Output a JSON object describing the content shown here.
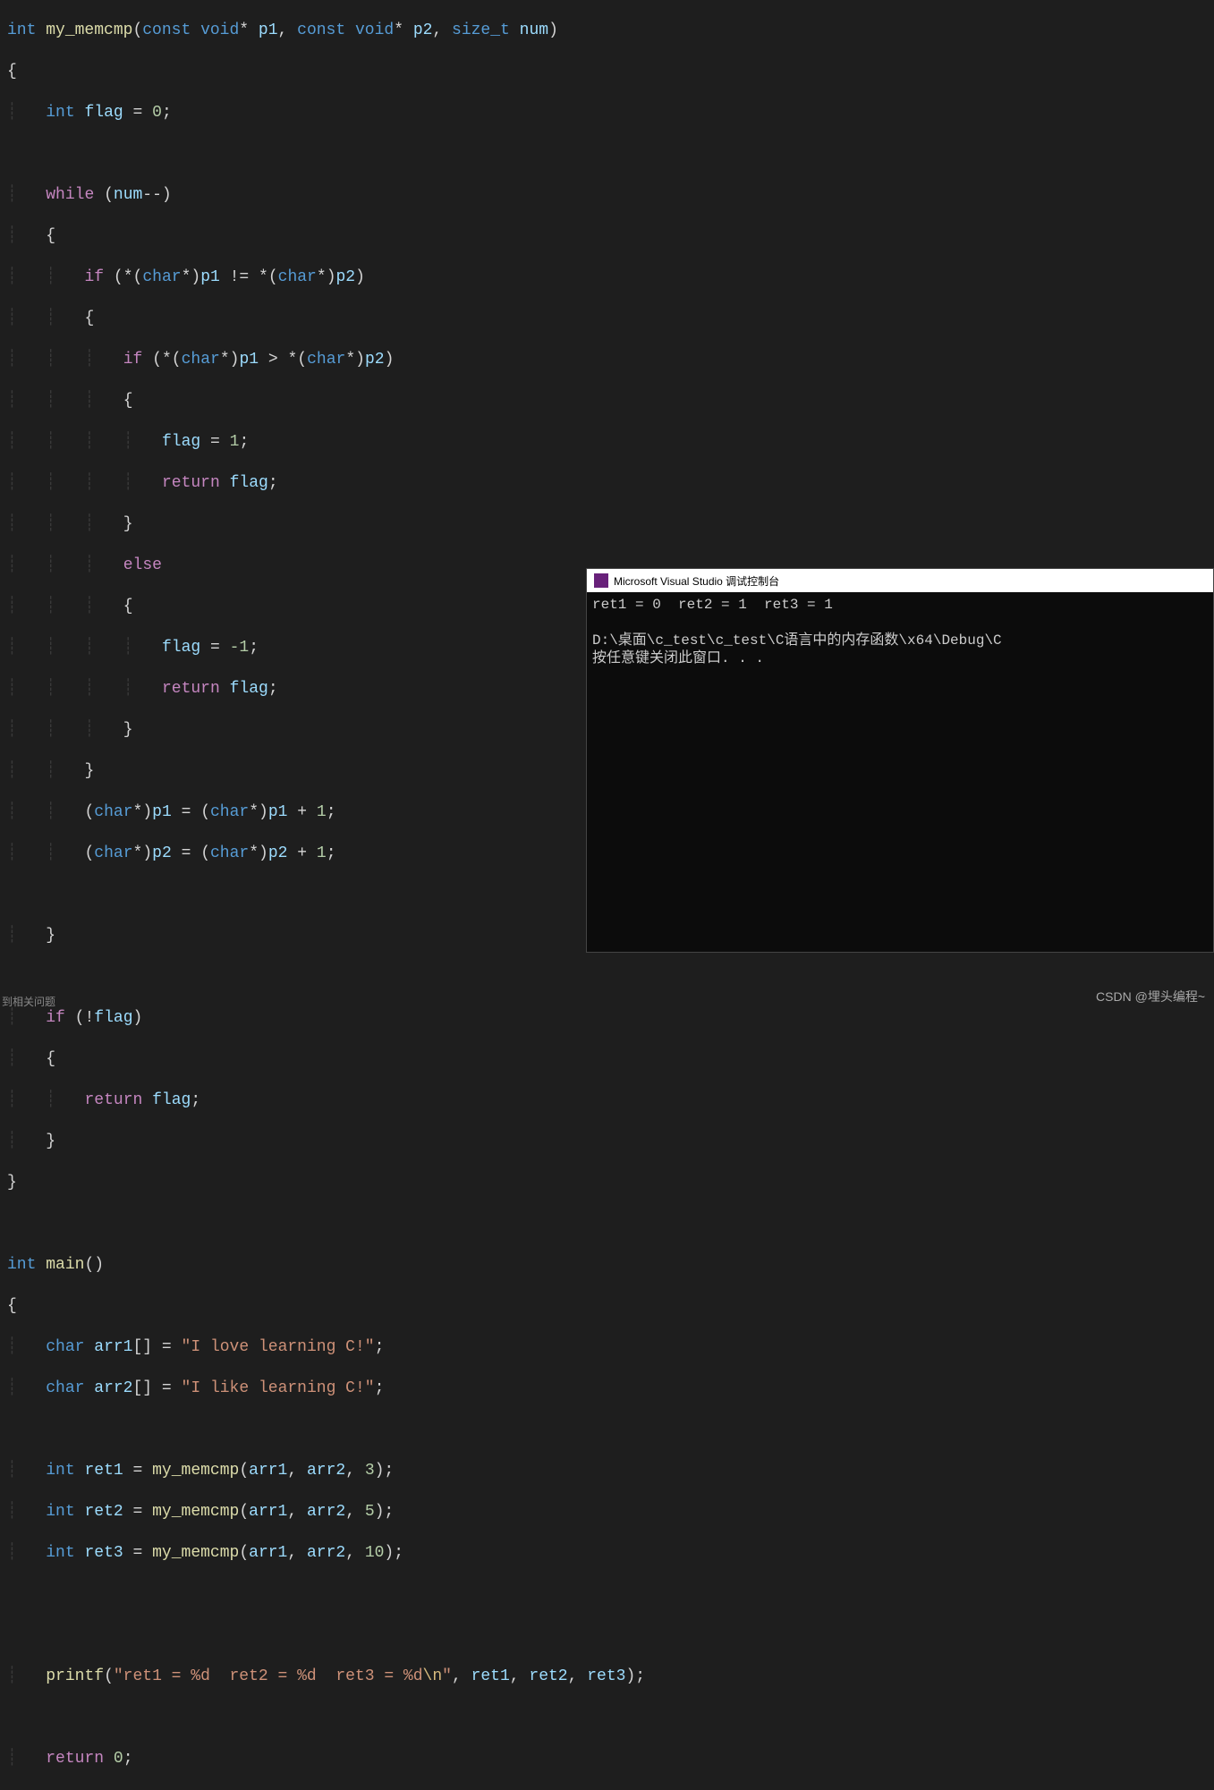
{
  "code": {
    "func_decl": {
      "ret": "int",
      "name": "my_memcmp",
      "params": [
        {
          "kw": "const",
          "type": "void",
          "ptr": "*",
          "name": "p1"
        },
        {
          "kw": "const",
          "type": "void",
          "ptr": "*",
          "name": "p2"
        },
        {
          "kw": "",
          "type": "size_t",
          "ptr": "",
          "name": "num"
        }
      ]
    },
    "flag_decl": {
      "type": "int",
      "name": "flag",
      "init": "0"
    },
    "while_kw": "while",
    "while_cond_var": "num",
    "while_op": "--",
    "if_kw": "if",
    "else_kw": "else",
    "return_kw": "return",
    "cast_type": "char",
    "cmp_ne": "!=",
    "cmp_gt": ">",
    "assign_1": "1",
    "assign_neg1": "-1",
    "plus_1": "1",
    "not_op": "!",
    "main_decl": {
      "ret": "int",
      "name": "main"
    },
    "arr1": {
      "type": "char",
      "name": "arr1",
      "lit": "\"I love learning C!\""
    },
    "arr2": {
      "type": "char",
      "name": "arr2",
      "lit": "\"I like learning C!\""
    },
    "ret1": {
      "type": "int",
      "name": "ret1",
      "call": "my_memcmp",
      "a1": "arr1",
      "a2": "arr2",
      "n": "3"
    },
    "ret2": {
      "type": "int",
      "name": "ret2",
      "call": "my_memcmp",
      "a1": "arr1",
      "a2": "arr2",
      "n": "5"
    },
    "ret3": {
      "type": "int",
      "name": "ret3",
      "call": "my_memcmp",
      "a1": "arr1",
      "a2": "arr2",
      "n": "10"
    },
    "printf": {
      "name": "printf",
      "fmt": "\"ret1 = %d  ret2 = %d  ret3 = %d",
      "esc": "\\n",
      "fmt_end": "\"",
      "a1": "ret1",
      "a2": "ret2",
      "a3": "ret3"
    },
    "return0": {
      "kw": "return",
      "val": "0"
    }
  },
  "console": {
    "title": "Microsoft Visual Studio 调试控制台",
    "out1": "ret1 = 0  ret2 = 1  ret3 = 1",
    "out2": "D:\\桌面\\c_test\\c_test\\C语言中的内存函数\\x64\\Debug\\C",
    "out3": "按任意键关闭此窗口. . ."
  },
  "footer_left": "到相关问题",
  "footer_right": "CSDN @埋头编程~"
}
